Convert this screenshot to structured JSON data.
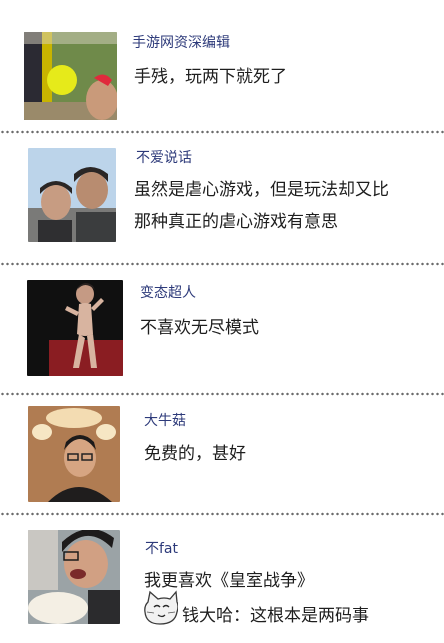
{
  "comments": [
    {
      "user": "手游网资深编辑",
      "lines": [
        "手残，玩两下就死了"
      ],
      "avatar": "avatar-photo-funny-face"
    },
    {
      "user": "不爱说话",
      "lines": [
        "虽然是虐心游戏，但是玩法却又比",
        "那种真正的虐心游戏有意思"
      ],
      "avatar": "avatar-photo-two-men"
    },
    {
      "user": "变态超人",
      "lines": [
        "不喜欢无尽模式"
      ],
      "avatar": "avatar-photo-standing-figure"
    },
    {
      "user": "大牛菇",
      "lines": [
        "免费的，甚好"
      ],
      "avatar": "avatar-photo-man-glasses"
    },
    {
      "user": "不fat",
      "lines": [
        "我更喜欢《皇室战争》"
      ],
      "avatar": "avatar-photo-man-eating"
    }
  ],
  "reply": {
    "icon": "cat-face-icon",
    "text": "钱大哈：这根本是两码事"
  }
}
